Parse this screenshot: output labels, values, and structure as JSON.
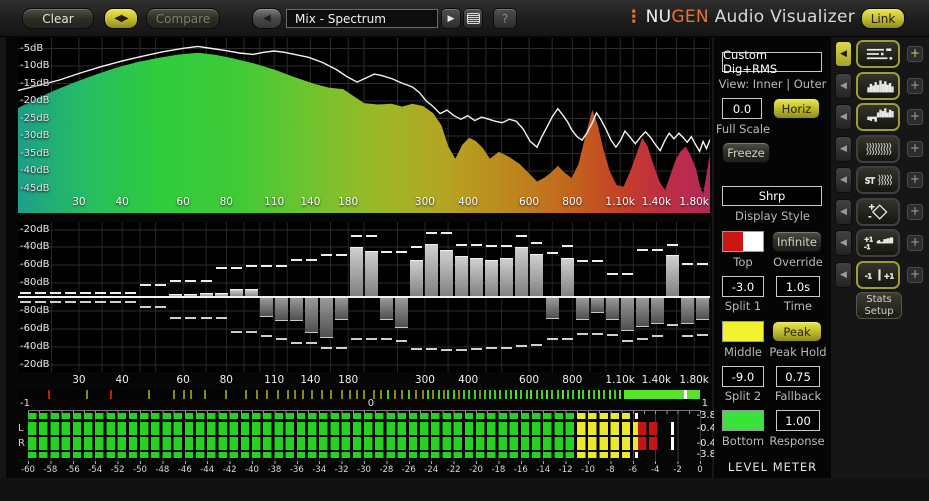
{
  "topbar": {
    "clear": "Clear",
    "compare": "Compare",
    "preset": "Mix - Spectrum",
    "nav_arrows": "◀▶",
    "prev": "◀",
    "play": "▶",
    "help": "?",
    "logo_mark": "⋮",
    "logo_nu": "NU",
    "logo_gen": "GEN",
    "logo_rest": " Audio Visualizer",
    "link": "Link"
  },
  "spectrum": {
    "db_labels": [
      "-5dB",
      "-10dB",
      "-15dB",
      "-20dB",
      "-25dB",
      "-30dB",
      "-35dB",
      "-40dB",
      "-45dB"
    ],
    "freq_labels": [
      {
        "t": "30",
        "f": 30
      },
      {
        "t": "40",
        "f": 40
      },
      {
        "t": "60",
        "f": 60
      },
      {
        "t": "80",
        "f": 80
      },
      {
        "t": "110",
        "f": 110
      },
      {
        "t": "140",
        "f": 140
      },
      {
        "t": "180",
        "f": 180
      },
      {
        "t": "300",
        "f": 300
      },
      {
        "t": "400",
        "f": 400
      },
      {
        "t": "600",
        "f": 600
      },
      {
        "t": "800",
        "f": 800
      },
      {
        "t": "1.10k",
        "f": 1100
      },
      {
        "t": "1.40k",
        "f": 1400
      },
      {
        "t": "1.80k",
        "f": 1800
      }
    ],
    "gradient": [
      [
        0,
        "#1d9e8a"
      ],
      [
        0.1,
        "#27bd62"
      ],
      [
        0.2,
        "#2fcc3e"
      ],
      [
        0.32,
        "#3fcb36"
      ],
      [
        0.42,
        "#6fc42e"
      ],
      [
        0.52,
        "#9cb827"
      ],
      [
        0.62,
        "#b5a422"
      ],
      [
        0.72,
        "#bd851e"
      ],
      [
        0.8,
        "#c3641d"
      ],
      [
        0.87,
        "#c44127"
      ],
      [
        0.93,
        "#c02c44"
      ],
      [
        1,
        "#b22a58"
      ]
    ],
    "fill": [
      [
        0,
        -22
      ],
      [
        0.02,
        -20
      ],
      [
        0.05,
        -17.2
      ],
      [
        0.08,
        -14.8
      ],
      [
        0.11,
        -12.6
      ],
      [
        0.14,
        -10.6
      ],
      [
        0.17,
        -9
      ],
      [
        0.2,
        -7.8
      ],
      [
        0.23,
        -6.8
      ],
      [
        0.26,
        -6.2
      ],
      [
        0.285,
        -6.8
      ],
      [
        0.31,
        -7.8
      ],
      [
        0.34,
        -9.2
      ],
      [
        0.37,
        -11
      ],
      [
        0.4,
        -13.2
      ],
      [
        0.43,
        -15.2
      ],
      [
        0.45,
        -16.2
      ],
      [
        0.47,
        -16.6
      ],
      [
        0.485,
        -18.6
      ],
      [
        0.5,
        -20.6
      ],
      [
        0.52,
        -21
      ],
      [
        0.54,
        -20.8
      ],
      [
        0.555,
        -21.6
      ],
      [
        0.57,
        -20.8
      ],
      [
        0.585,
        -21.4
      ],
      [
        0.6,
        -23.5
      ],
      [
        0.612,
        -27
      ],
      [
        0.622,
        -33
      ],
      [
        0.632,
        -36.5
      ],
      [
        0.642,
        -32.5
      ],
      [
        0.652,
        -30.5
      ],
      [
        0.662,
        -31.5
      ],
      [
        0.672,
        -33.5
      ],
      [
        0.682,
        -36.5
      ],
      [
        0.695,
        -34.5
      ],
      [
        0.71,
        -36
      ],
      [
        0.725,
        -38
      ],
      [
        0.74,
        -41
      ],
      [
        0.75,
        -43
      ],
      [
        0.76,
        -42
      ],
      [
        0.77,
        -40.5
      ],
      [
        0.78,
        -38.5
      ],
      [
        0.79,
        -40.5
      ],
      [
        0.8,
        -42
      ],
      [
        0.81,
        -38
      ],
      [
        0.82,
        -30
      ],
      [
        0.83,
        -22.5
      ],
      [
        0.838,
        -27
      ],
      [
        0.845,
        -33
      ],
      [
        0.855,
        -40
      ],
      [
        0.865,
        -44
      ],
      [
        0.875,
        -44.5
      ],
      [
        0.885,
        -40
      ],
      [
        0.895,
        -34.5
      ],
      [
        0.902,
        -30.5
      ],
      [
        0.91,
        -33
      ],
      [
        0.918,
        -38
      ],
      [
        0.927,
        -43
      ],
      [
        0.935,
        -45.5
      ],
      [
        0.943,
        -41
      ],
      [
        0.95,
        -37
      ],
      [
        0.957,
        -34.5
      ],
      [
        0.965,
        -33
      ],
      [
        0.972,
        -35.5
      ],
      [
        0.98,
        -39.5
      ],
      [
        0.985,
        -44
      ],
      [
        0.99,
        -46.5
      ],
      [
        0.995,
        -41
      ],
      [
        1,
        -35
      ]
    ],
    "outer": [
      [
        0,
        -17
      ],
      [
        0.03,
        -15.5
      ],
      [
        0.06,
        -14
      ],
      [
        0.09,
        -12
      ],
      [
        0.12,
        -10.2
      ],
      [
        0.15,
        -8.6
      ],
      [
        0.18,
        -7.2
      ],
      [
        0.21,
        -5.9
      ],
      [
        0.24,
        -4.9
      ],
      [
        0.26,
        -4.4
      ],
      [
        0.28,
        -5
      ],
      [
        0.3,
        -5.6
      ],
      [
        0.32,
        -6.3
      ],
      [
        0.34,
        -6.7
      ],
      [
        0.355,
        -6.1
      ],
      [
        0.37,
        -5.7
      ],
      [
        0.385,
        -6.1
      ],
      [
        0.4,
        -6.7
      ],
      [
        0.42,
        -7.5
      ],
      [
        0.44,
        -9
      ],
      [
        0.46,
        -11
      ],
      [
        0.475,
        -13
      ],
      [
        0.49,
        -14.6
      ],
      [
        0.505,
        -13.2
      ],
      [
        0.515,
        -12.3
      ],
      [
        0.525,
        -12.7
      ],
      [
        0.54,
        -13.6
      ],
      [
        0.555,
        -14.9
      ],
      [
        0.57,
        -16
      ],
      [
        0.58,
        -17.6
      ],
      [
        0.59,
        -20
      ],
      [
        0.6,
        -21.6
      ],
      [
        0.61,
        -23.6
      ],
      [
        0.62,
        -22.6
      ],
      [
        0.63,
        -24.2
      ],
      [
        0.64,
        -25.2
      ],
      [
        0.65,
        -24.2
      ],
      [
        0.66,
        -25.6
      ],
      [
        0.67,
        -24.6
      ],
      [
        0.68,
        -25.2
      ],
      [
        0.69,
        -25.8
      ],
      [
        0.7,
        -26.2
      ],
      [
        0.71,
        -25.2
      ],
      [
        0.72,
        -25.8
      ],
      [
        0.73,
        -28
      ],
      [
        0.74,
        -31.5
      ],
      [
        0.75,
        -33.2
      ],
      [
        0.757,
        -30.2
      ],
      [
        0.765,
        -27.2
      ],
      [
        0.772,
        -24.5
      ],
      [
        0.78,
        -22.2
      ],
      [
        0.788,
        -24.2
      ],
      [
        0.795,
        -26.2
      ],
      [
        0.8,
        -28.2
      ],
      [
        0.808,
        -30.2
      ],
      [
        0.815,
        -31.2
      ],
      [
        0.822,
        -29.2
      ],
      [
        0.83,
        -26.2
      ],
      [
        0.836,
        -23.4
      ],
      [
        0.842,
        -25.2
      ],
      [
        0.85,
        -28.2
      ],
      [
        0.857,
        -31.2
      ],
      [
        0.864,
        -33.2
      ],
      [
        0.871,
        -31.2
      ],
      [
        0.877,
        -28.6
      ],
      [
        0.884,
        -30.2
      ],
      [
        0.892,
        -32.2
      ],
      [
        0.9,
        -30.2
      ],
      [
        0.907,
        -28.8
      ],
      [
        0.914,
        -30.4
      ],
      [
        0.921,
        -32.4
      ],
      [
        0.928,
        -34.2
      ],
      [
        0.935,
        -31.2
      ],
      [
        0.941,
        -29.2
      ],
      [
        0.948,
        -30.8
      ],
      [
        0.955,
        -29.2
      ],
      [
        0.961,
        -30.4
      ],
      [
        0.967,
        -31.8
      ],
      [
        0.973,
        -30.2
      ],
      [
        0.979,
        -32.4
      ],
      [
        0.985,
        -34.4
      ],
      [
        0.99,
        -31.6
      ],
      [
        0.995,
        -33.6
      ],
      [
        1,
        -31
      ]
    ]
  },
  "mirror": {
    "db_top": [
      "-20dB",
      "-40dB",
      "-60dB",
      "-80dB"
    ],
    "db_bottom": [
      "-80dB",
      "-60dB",
      "-40dB",
      "-20dB"
    ],
    "up": [
      0,
      0,
      0,
      0,
      0,
      0,
      0,
      0,
      0,
      0,
      0.03,
      0.03,
      0.04,
      0.04,
      0.1,
      0.1,
      0,
      0,
      0,
      0,
      0,
      0,
      0.7,
      0.64,
      0,
      0,
      0.52,
      0.74,
      0.66,
      0.57,
      0.54,
      0.52,
      0.54,
      0.7,
      0.6,
      0,
      0.55,
      0,
      0,
      0,
      0,
      0,
      0,
      0.58,
      0,
      0
    ],
    "down": [
      0,
      0,
      0,
      0,
      0,
      0,
      0,
      0,
      0,
      0,
      0,
      0,
      0,
      0,
      0,
      0,
      0.25,
      0.32,
      0.32,
      0.48,
      0.55,
      0.3,
      0,
      0,
      0.3,
      0.42,
      0,
      0,
      0,
      0,
      0,
      0,
      0,
      0,
      0,
      0.28,
      0,
      0.3,
      0.2,
      0.3,
      0.45,
      0.4,
      0.35,
      0,
      0.35,
      0.3
    ],
    "peak_up": [
      0.03,
      0.03,
      0.03,
      0.03,
      0.03,
      0.03,
      0.03,
      0.03,
      0.15,
      0.15,
      0.2,
      0.2,
      0.2,
      0.38,
      0.38,
      0.41,
      0.41,
      0.41,
      0.5,
      0.5,
      0.57,
      0.57,
      0.85,
      0.85,
      0.62,
      0.62,
      0.68,
      0.88,
      0.88,
      0.72,
      0.72,
      0.7,
      0.7,
      0.84,
      0.74,
      0.6,
      0.7,
      0.48,
      0.48,
      0.3,
      0.3,
      0.65,
      0.65,
      0.72,
      0.45,
      0.45
    ],
    "peak_down": [
      0.03,
      0.03,
      0.03,
      0.03,
      0.03,
      0.03,
      0.03,
      0.03,
      0.1,
      0.1,
      0.25,
      0.25,
      0.25,
      0.25,
      0.45,
      0.45,
      0.52,
      0.55,
      0.62,
      0.62,
      0.68,
      0.68,
      0.55,
      0.55,
      0.55,
      0.58,
      0.7,
      0.7,
      0.72,
      0.72,
      0.7,
      0.68,
      0.68,
      0.66,
      0.64,
      0.55,
      0.55,
      0.48,
      0.48,
      0.5,
      0.58,
      0.55,
      0.52,
      0.35,
      0.52,
      0.5
    ]
  },
  "correlation": {
    "neg": "-1",
    "zero": "0",
    "pos": "1",
    "solid_from": 0.875,
    "solid_to": 0.985,
    "marker": 0.962,
    "colors": {
      "r": "#b02015",
      "o": "#8a8a12",
      "g": "#3ad41e",
      "b": "#55e42a"
    },
    "ticks": [
      [
        0.045,
        "r"
      ],
      [
        0.1,
        "o"
      ],
      [
        0.135,
        "r"
      ],
      [
        0.19,
        "o"
      ],
      [
        0.225,
        "o"
      ],
      [
        0.24,
        "o"
      ],
      [
        0.25,
        "o"
      ],
      [
        0.27,
        "o"
      ],
      [
        0.3,
        "o"
      ],
      [
        0.33,
        "o"
      ],
      [
        0.345,
        "o"
      ],
      [
        0.36,
        "o"
      ],
      [
        0.375,
        "o"
      ],
      [
        0.39,
        "o"
      ],
      [
        0.4,
        "o"
      ],
      [
        0.412,
        "o"
      ],
      [
        0.425,
        "o"
      ],
      [
        0.44,
        "o"
      ],
      [
        0.452,
        "o"
      ],
      [
        0.468,
        "o"
      ],
      [
        0.48,
        "o"
      ],
      [
        0.49,
        "o"
      ],
      [
        0.5,
        "o"
      ],
      [
        0.515,
        "o"
      ],
      [
        0.525,
        "o"
      ],
      [
        0.535,
        "g"
      ],
      [
        0.545,
        "o"
      ],
      [
        0.555,
        "o"
      ],
      [
        0.565,
        "g"
      ],
      [
        0.575,
        "o"
      ],
      [
        0.585,
        "o"
      ],
      [
        0.592,
        "g"
      ],
      [
        0.6,
        "o"
      ],
      [
        0.608,
        "g"
      ],
      [
        0.615,
        "o"
      ],
      [
        0.622,
        "g"
      ],
      [
        0.63,
        "g"
      ],
      [
        0.638,
        "o"
      ],
      [
        0.645,
        "g"
      ],
      [
        0.652,
        "g"
      ],
      [
        0.66,
        "g"
      ],
      [
        0.668,
        "o"
      ],
      [
        0.675,
        "g"
      ],
      [
        0.682,
        "g"
      ],
      [
        0.69,
        "g"
      ],
      [
        0.697,
        "g"
      ],
      [
        0.705,
        "g"
      ],
      [
        0.712,
        "g"
      ],
      [
        0.72,
        "b"
      ],
      [
        0.727,
        "g"
      ],
      [
        0.735,
        "g"
      ],
      [
        0.742,
        "b"
      ],
      [
        0.75,
        "g"
      ],
      [
        0.757,
        "g"
      ],
      [
        0.765,
        "b"
      ],
      [
        0.772,
        "g"
      ],
      [
        0.78,
        "g"
      ],
      [
        0.787,
        "b"
      ],
      [
        0.795,
        "g"
      ],
      [
        0.802,
        "g"
      ],
      [
        0.81,
        "b"
      ],
      [
        0.817,
        "g"
      ],
      [
        0.825,
        "b"
      ],
      [
        0.832,
        "g"
      ],
      [
        0.84,
        "b"
      ],
      [
        0.847,
        "g"
      ],
      [
        0.855,
        "b"
      ],
      [
        0.862,
        "g"
      ],
      [
        0.87,
        "b"
      ]
    ]
  },
  "meter": {
    "yellow_from": -11,
    "red_from": -5.5,
    "colors": {
      "green": "#23d41f",
      "yellow": "#ece82a",
      "red": "#c41414"
    },
    "rows": [
      {
        "kind": "thin",
        "label": "",
        "bar_to": -6.1,
        "cap": -5.8,
        "readout": "-3.8"
      },
      {
        "kind": "thick",
        "label": "L",
        "bar_to": -3.6,
        "peak": -2.6,
        "readout": "-0.4"
      },
      {
        "kind": "thick",
        "label": "R",
        "bar_to": -3.6,
        "peak": -2.6,
        "readout": "-0.4"
      },
      {
        "kind": "thin",
        "label": "",
        "bar_to": -6.1,
        "cap": -5.8,
        "readout": "-3.8"
      }
    ],
    "scale": [
      "-60",
      "-58",
      "-56",
      "-54",
      "-52",
      "-50",
      "-48",
      "-46",
      "-44",
      "-42",
      "-40",
      "-38",
      "-36",
      "-34",
      "-32",
      "-30",
      "-28",
      "-26",
      "-24",
      "-22",
      "-20",
      "-18",
      "-16",
      "-14",
      "-12",
      "-10",
      "-8",
      "-6",
      "-4",
      "-2",
      "0"
    ]
  },
  "controls": {
    "mode": "Custom Dig+RMS",
    "view": "View: Inner | Outer",
    "full_scale_value": "0.0",
    "horiz": "Horiz",
    "full_scale_label": "Full Scale",
    "freeze": "Freeze",
    "display_style_value": "Shrp",
    "display_style_label": "Display Style",
    "top_label": "Top",
    "override_btn": "Infinite",
    "override_label": "Override",
    "split1_value": "-3.0",
    "split1_label": "Split 1",
    "time_value": "1.0s",
    "time_label": "Time",
    "middle_label": "Middle",
    "peak_btn": "Peak",
    "peak_hold_label": "Peak Hold",
    "split2_value": "-9.0",
    "split2_label": "Split 2",
    "fallback_value": "0.75",
    "fallback_label": "Fallback",
    "bottom_label": "Bottom",
    "response_value": "1.00",
    "response_label": "Response",
    "title": "LEVEL METER",
    "swatch_colors": {
      "top_left": "#cc1414",
      "top_right": "#ffffff",
      "middle": "#f2f22e",
      "bottom": "#3ae23a"
    }
  },
  "strip": {
    "plus": "+",
    "arrow": "◀",
    "rows": [
      {
        "icon": "meter-history",
        "selected": true,
        "arrow_active": true
      },
      {
        "icon": "spectrum",
        "selected": true,
        "arrow_active": false
      },
      {
        "icon": "spectrum-split",
        "selected": true,
        "arrow_active": false
      },
      {
        "icon": "spectrogram",
        "selected": false,
        "arrow_active": false
      },
      {
        "icon": "stereo-spectrogram",
        "selected": false,
        "arrow_active": false
      },
      {
        "icon": "vectorscope",
        "selected": false,
        "arrow_active": false
      },
      {
        "icon": "correlation-spectrum",
        "selected": false,
        "arrow_active": false
      },
      {
        "icon": "correlation-meter",
        "selected": true,
        "arrow_active": false
      }
    ],
    "stats_line1": "Stats",
    "stats_line2": "Setup"
  }
}
